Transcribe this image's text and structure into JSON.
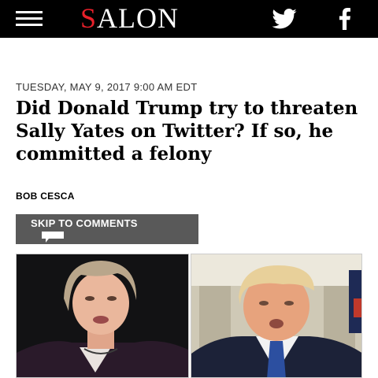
{
  "header": {
    "logo_first": "S",
    "logo_rest": "ALON",
    "menu_icon": "hamburger-menu-icon",
    "social": [
      "twitter-icon",
      "facebook-icon"
    ]
  },
  "article": {
    "dateline": "TUESDAY, MAY 9, 2017 9:00 AM EDT",
    "headline": "Did Donald Trump try to threaten Sally Yates on Twitter? If so, he committed a felony",
    "byline": "BOB CESCA",
    "skip_label": "SKIP TO COMMENTS",
    "comment_icon": "comment-bubble-icon"
  },
  "colors": {
    "brand_red": "#e8202a",
    "header_bg": "#000000",
    "button_bg": "#595959"
  }
}
